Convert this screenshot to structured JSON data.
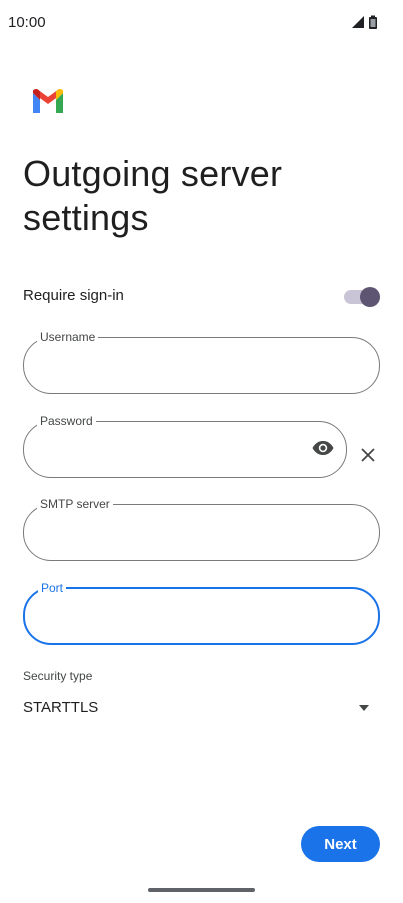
{
  "status_bar": {
    "time": "10:00",
    "icons": [
      "signal-icon",
      "battery-icon"
    ]
  },
  "app": {
    "logo": "gmail-logo"
  },
  "page": {
    "title_line1": "Outgoing server",
    "title_line2": "settings"
  },
  "require_signin": {
    "label": "Require sign-in",
    "enabled": true
  },
  "fields": {
    "username": {
      "label": "Username",
      "value": ""
    },
    "password": {
      "label": "Password",
      "value": ""
    },
    "smtp_server": {
      "label": "SMTP server",
      "value": ""
    },
    "port": {
      "label": "Port",
      "value": ""
    }
  },
  "security": {
    "label": "Security type",
    "value": "STARTTLS"
  },
  "actions": {
    "next_label": "Next"
  },
  "colors": {
    "accent": "#1a73e8",
    "toggle_thumb": "#5d5572",
    "toggle_track": "#c9c5d6"
  }
}
